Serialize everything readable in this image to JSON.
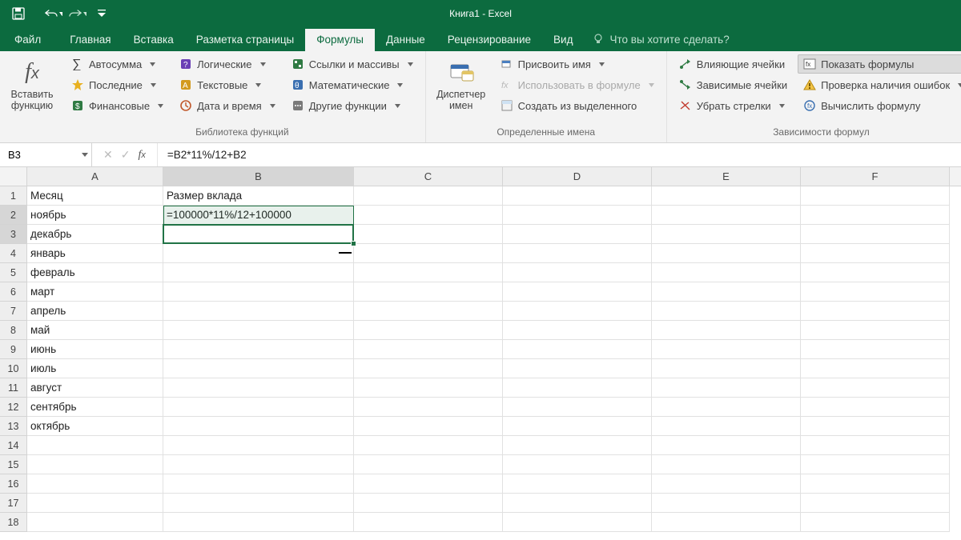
{
  "app": {
    "title": "Книга1 - Excel"
  },
  "qat": {
    "save": "save",
    "undo": "undo",
    "redo": "redo"
  },
  "tabs": {
    "file": "Файл",
    "items": [
      "Главная",
      "Вставка",
      "Разметка страницы",
      "Формулы",
      "Данные",
      "Рецензирование",
      "Вид"
    ],
    "active_index": 3,
    "tell_me": "Что вы хотите сделать?"
  },
  "ribbon": {
    "insert_function": "Вставить функцию",
    "lib": {
      "title": "Библиотека функций",
      "autosum": "Автосумма",
      "recent": "Последние",
      "financial": "Финансовые",
      "logical": "Логические",
      "text": "Текстовые",
      "datetime": "Дата и время",
      "lookup": "Ссылки и массивы",
      "math": "Математические",
      "other": "Другие функции"
    },
    "name_manager": "Диспетчер имен",
    "defined": {
      "title": "Определенные имена",
      "define": "Присвоить имя",
      "use": "Использовать в формуле",
      "create": "Создать из выделенного"
    },
    "audit": {
      "title": "Зависимости формул",
      "precedents": "Влияющие ячейки",
      "dependents": "Зависимые ячейки",
      "remove": "Убрать стрелки",
      "show_formulas": "Показать формулы",
      "errors": "Проверка наличия ошибок",
      "evaluate": "Вычислить формулу"
    }
  },
  "namebox": "B3",
  "formula_bar": "=B2*11%/12+B2",
  "columns": [
    "A",
    "B",
    "C",
    "D",
    "E",
    "F"
  ],
  "selected_col_index": 1,
  "selected_row_index": 2,
  "grid": {
    "rows": [
      {
        "n": 1,
        "A": "Месяц",
        "B": "Размер вклада"
      },
      {
        "n": 2,
        "A": "ноябрь",
        "B_formula": "=100000*11%/12+100000"
      },
      {
        "n": 3,
        "A": "декабрь",
        "B_formula_parts": [
          "=",
          "B2",
          "*11%/12+",
          "B2"
        ]
      },
      {
        "n": 4,
        "A": "январь"
      },
      {
        "n": 5,
        "A": "февраль"
      },
      {
        "n": 6,
        "A": "март"
      },
      {
        "n": 7,
        "A": "апрель"
      },
      {
        "n": 8,
        "A": "май"
      },
      {
        "n": 9,
        "A": "июнь"
      },
      {
        "n": 10,
        "A": "июль"
      },
      {
        "n": 11,
        "A": "август"
      },
      {
        "n": 12,
        "A": "сентябрь"
      },
      {
        "n": 13,
        "A": "октябрь"
      },
      {
        "n": 14
      },
      {
        "n": 15
      },
      {
        "n": 16
      },
      {
        "n": 17
      },
      {
        "n": 18
      }
    ]
  },
  "selection": {
    "range": "B2:B3",
    "active": "B3"
  }
}
